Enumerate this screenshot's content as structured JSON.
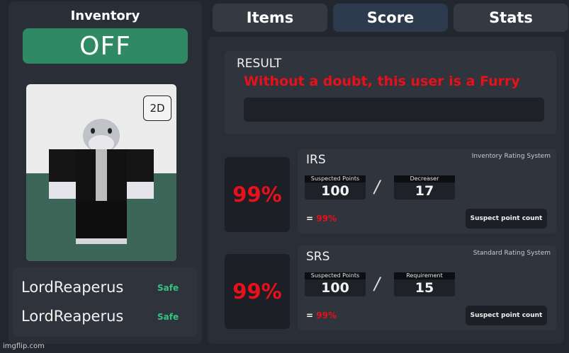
{
  "inventory": {
    "title": "Inventory",
    "toggle_label": "OFF",
    "view_button": "2D"
  },
  "users": [
    {
      "name": "LordReaperus",
      "status": "Safe"
    },
    {
      "name": "LordReaperus",
      "status": "Safe"
    }
  ],
  "tabs": [
    {
      "label": "Items",
      "active": false
    },
    {
      "label": "Score",
      "active": true
    },
    {
      "label": "Stats",
      "active": false
    }
  ],
  "result": {
    "title": "RESULT",
    "text": "Without a doubt, this user is a Furry"
  },
  "systems": [
    {
      "percent": "99%",
      "name": "IRS",
      "full_name": "Inventory Rating System",
      "left_label": "Suspected Points",
      "left_value": "100",
      "right_label": "Decreaser",
      "right_value": "17",
      "equals": "=",
      "equals_percent": "99%",
      "button": "Suspect point count"
    },
    {
      "percent": "99%",
      "name": "SRS",
      "full_name": "Standard Rating System",
      "left_label": "Suspected Points",
      "left_value": "100",
      "right_label": "Requirement",
      "right_value": "15",
      "equals": "=",
      "equals_percent": "99%",
      "button": "Suspect point count"
    }
  ],
  "separator": "/",
  "watermark": "imgflip.com",
  "colors": {
    "toggle_off": "#2f8a64",
    "alert_red": "#e8101a",
    "safe_green": "#34c280"
  }
}
